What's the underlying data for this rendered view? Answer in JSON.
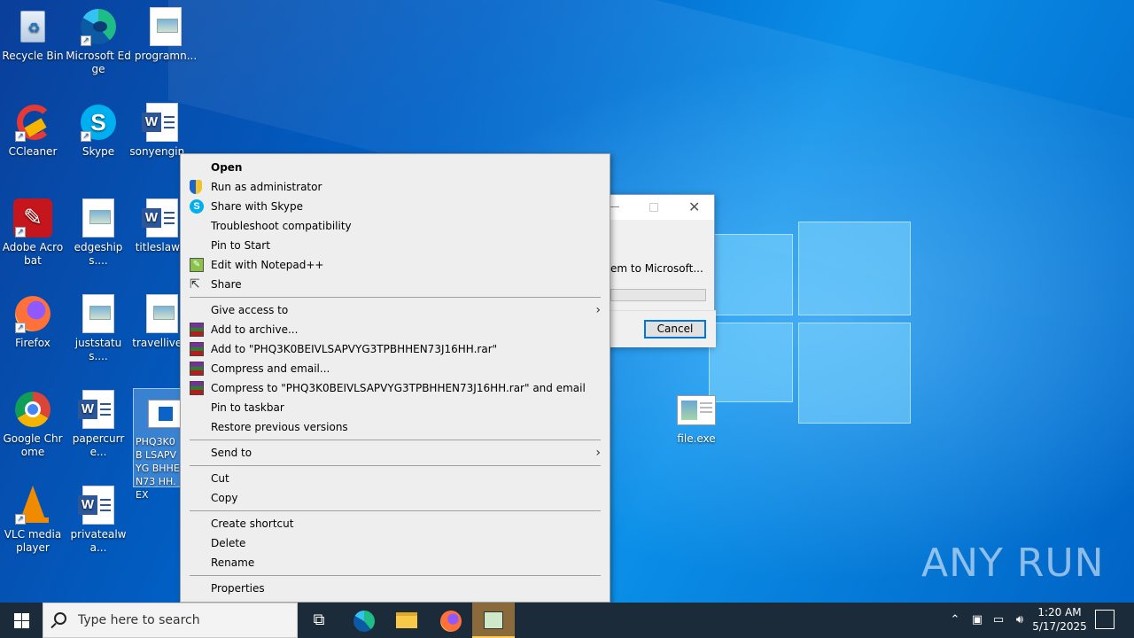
{
  "desktop": {
    "icons": [
      {
        "label": "Recycle Bin"
      },
      {
        "label": "Microsoft Edge"
      },
      {
        "label": "programn..."
      },
      {
        "label": "CCleaner"
      },
      {
        "label": "Skype"
      },
      {
        "label": "sonyengin..."
      },
      {
        "label": "Adobe Acrobat"
      },
      {
        "label": "edgeships...."
      },
      {
        "label": "titleslaw..."
      },
      {
        "label": "Firefox"
      },
      {
        "label": "juststatus...."
      },
      {
        "label": "travellive..."
      },
      {
        "label": "Google Chrome"
      },
      {
        "label": "papercurre..."
      },
      {
        "label": "PHQ3K0B LSAPVYG BHHEN73 HH.EX"
      },
      {
        "label": "VLC media player"
      },
      {
        "label": "privatealwa..."
      },
      {
        "label": "file.exe"
      }
    ]
  },
  "dialog": {
    "message": "em to Microsoft...",
    "cancel_label": "Cancel"
  },
  "context_menu": {
    "items": [
      {
        "label": "Open"
      },
      {
        "label": "Run as administrator"
      },
      {
        "label": "Share with Skype"
      },
      {
        "label": "Troubleshoot compatibility"
      },
      {
        "label": "Pin to Start"
      },
      {
        "label": "Edit with Notepad++"
      },
      {
        "label": "Share"
      },
      {
        "label": "Give access to"
      },
      {
        "label": "Add to archive..."
      },
      {
        "label": "Add to \"PHQ3K0BEIVLSAPVYG3TPBHHEN73J16HH.rar\""
      },
      {
        "label": "Compress and email..."
      },
      {
        "label": "Compress to \"PHQ3K0BEIVLSAPVYG3TPBHHEN73J16HH.rar\" and email"
      },
      {
        "label": "Pin to taskbar"
      },
      {
        "label": "Restore previous versions"
      },
      {
        "label": "Send to"
      },
      {
        "label": "Cut"
      },
      {
        "label": "Copy"
      },
      {
        "label": "Create shortcut"
      },
      {
        "label": "Delete"
      },
      {
        "label": "Rename"
      },
      {
        "label": "Properties"
      }
    ]
  },
  "taskbar": {
    "search_placeholder": "Type here to search",
    "time": "1:20 AM",
    "date": "5/17/2025"
  },
  "watermark": "ANY RUN",
  "colors": {
    "desktop_blue": "#0078d7",
    "taskbar": "#1c2b3a",
    "menu_bg": "#eeeeee"
  }
}
